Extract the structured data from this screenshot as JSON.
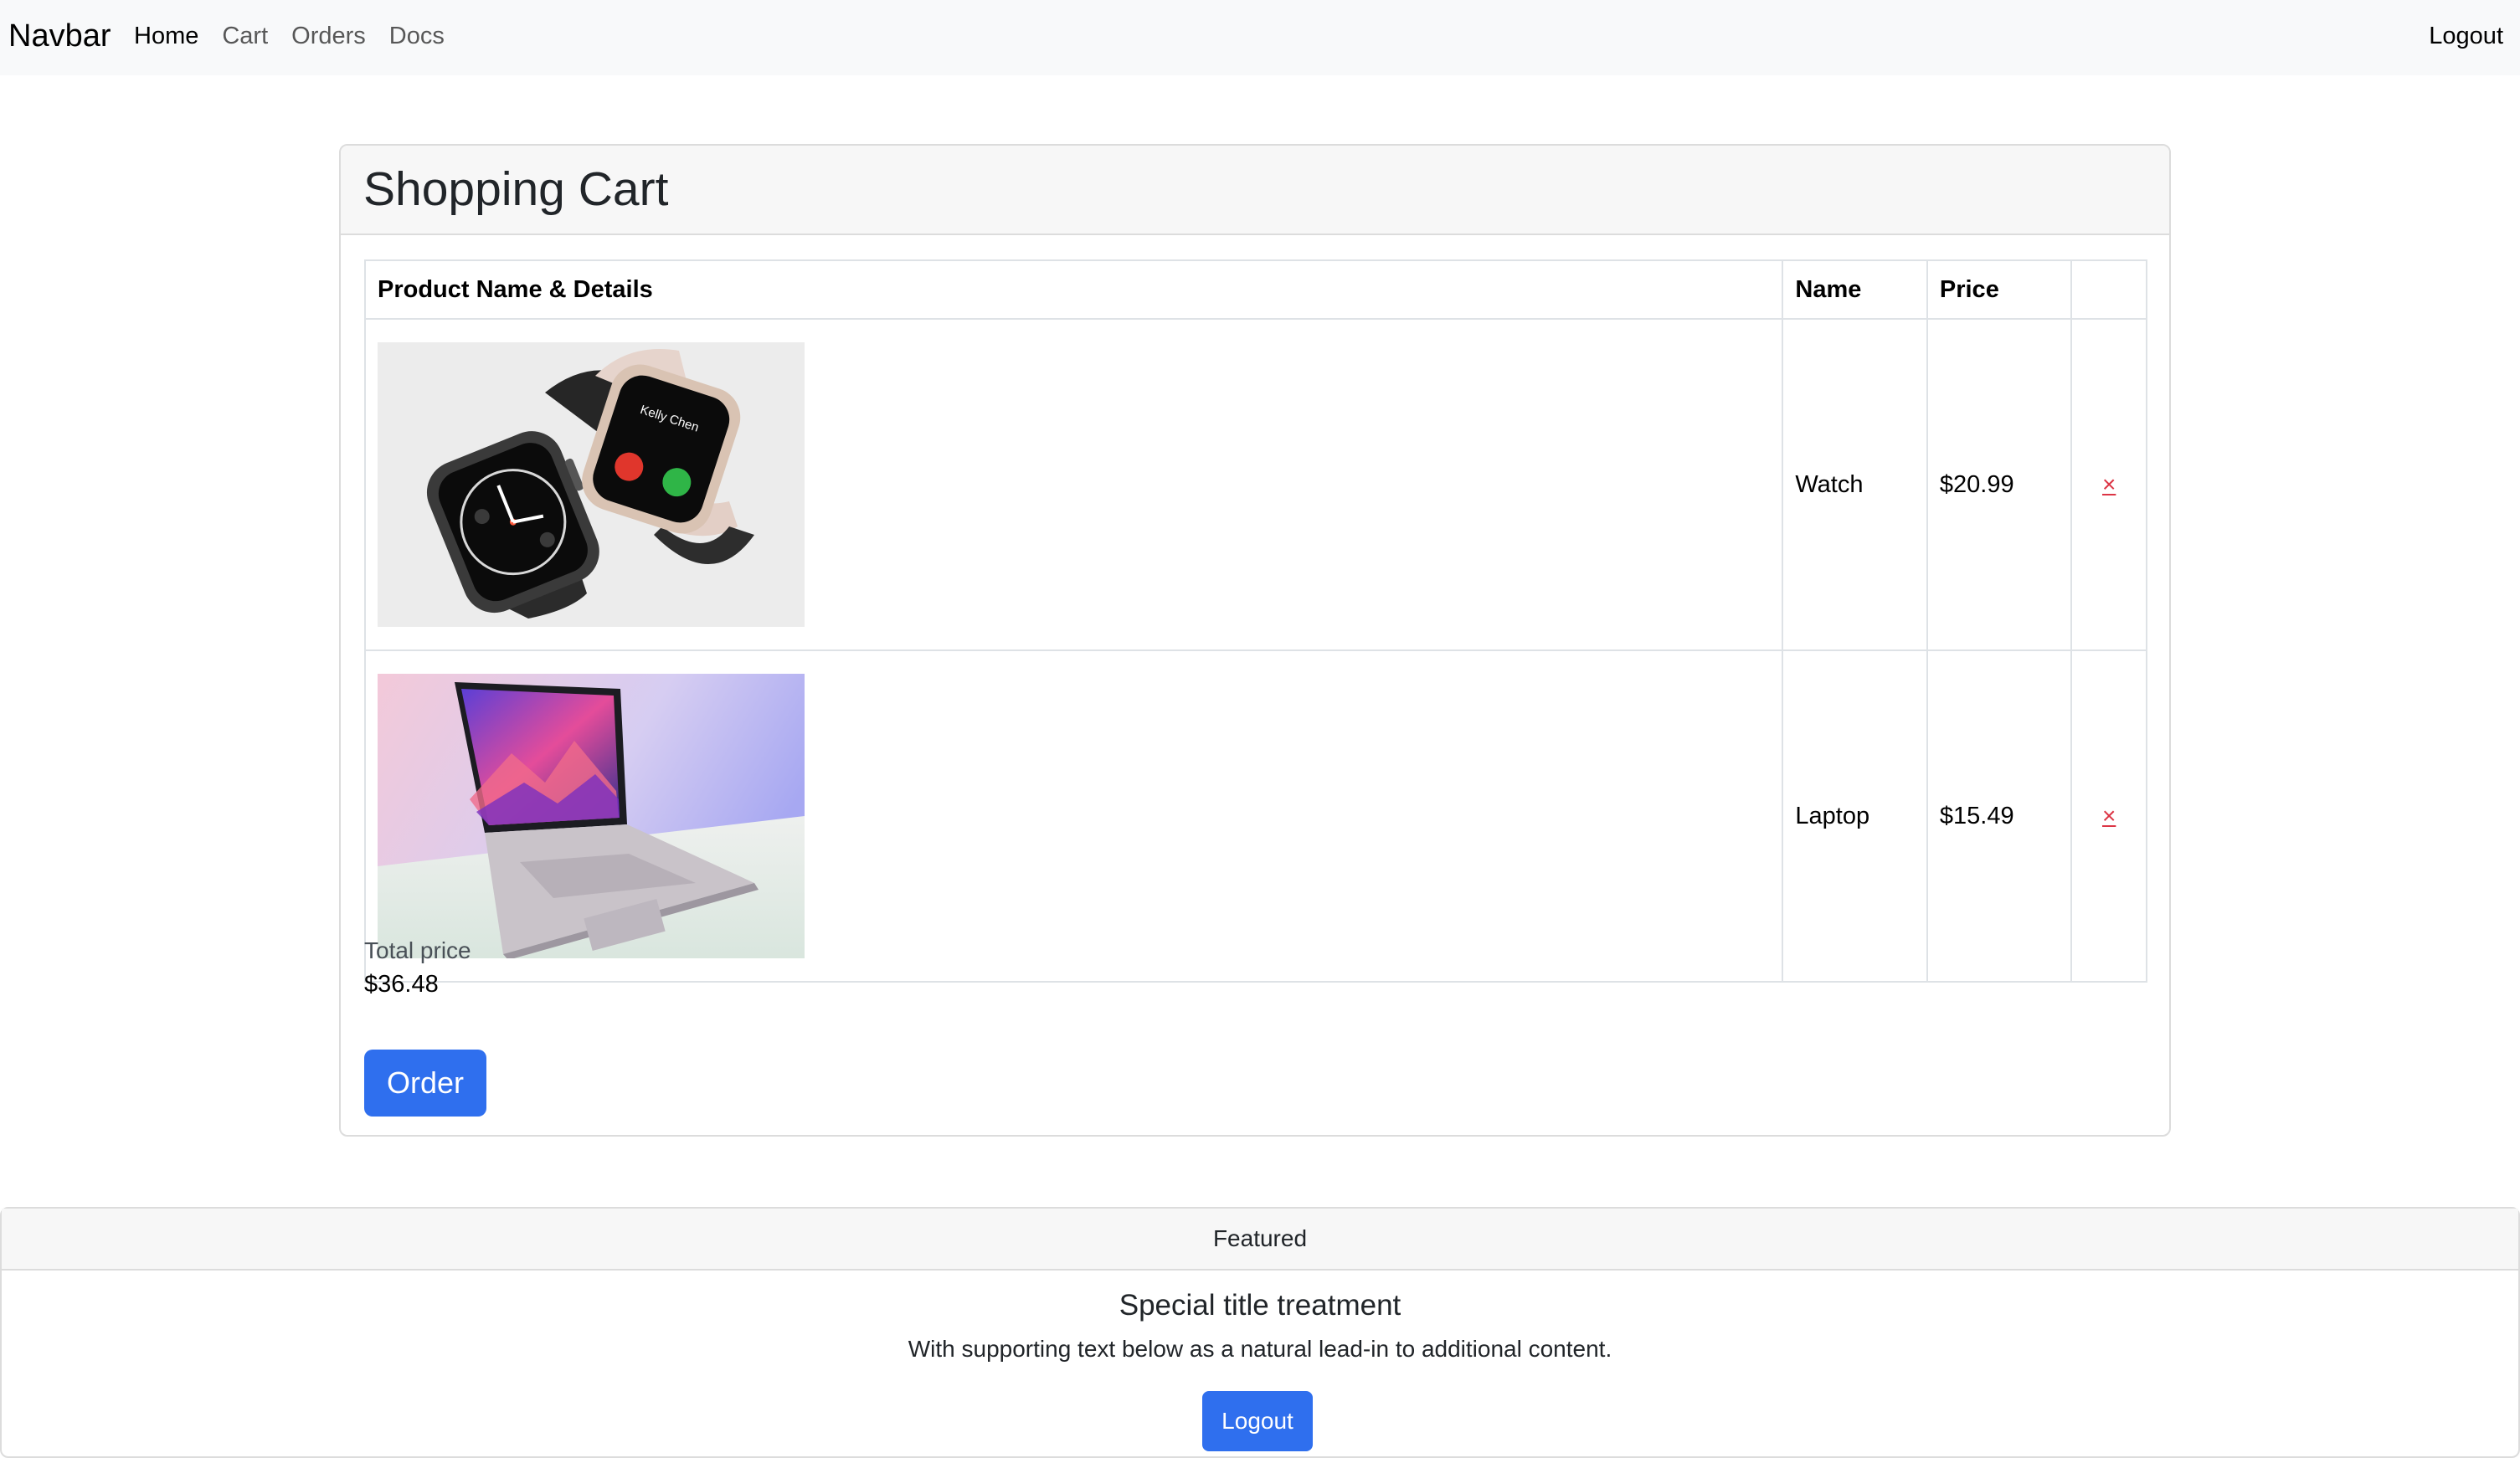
{
  "navbar": {
    "brand": "Navbar",
    "links": [
      {
        "label": "Home",
        "active": true
      },
      {
        "label": "Cart",
        "active": false
      },
      {
        "label": "Orders",
        "active": false
      },
      {
        "label": "Docs",
        "active": false
      }
    ],
    "logout_label": "Logout"
  },
  "cart": {
    "title": "Shopping Cart",
    "columns": {
      "product": "Product Name & Details",
      "name": "Name",
      "price": "Price",
      "remove": ""
    },
    "items": [
      {
        "image_icon": "smartwatch-image",
        "name": "Watch",
        "price": "$20.99",
        "remove_label": "×"
      },
      {
        "image_icon": "laptop-image",
        "name": "Laptop",
        "price": "$15.49",
        "remove_label": "×"
      }
    ],
    "total_label": "Total price",
    "total_value": "$36.48",
    "order_label": "Order"
  },
  "featured": {
    "header": "Featured",
    "title": "Special title treatment",
    "text": "With supporting text below as a natural lead-in to additional content.",
    "button_label": "Logout"
  },
  "colors": {
    "primary": "#2f6fee",
    "danger": "#dc3545",
    "navbar_bg": "#f8f9fa",
    "card_header_bg": "#f7f7f7"
  }
}
